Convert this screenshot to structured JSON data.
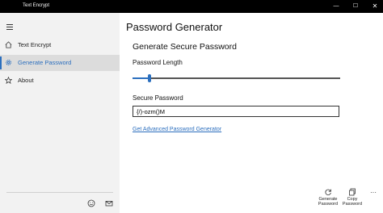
{
  "window": {
    "title": "Text Encrypt",
    "min_glyph": "—",
    "max_glyph": "☐",
    "close_glyph": "✕"
  },
  "sidebar": {
    "items": [
      {
        "label": "Text Encrypt",
        "icon": "home-icon",
        "active": false
      },
      {
        "label": "Generate Password",
        "icon": "gear-icon",
        "active": true
      },
      {
        "label": "About",
        "icon": "star-icon",
        "active": false
      }
    ],
    "footer_icons": [
      "feedback-icon",
      "mail-icon"
    ]
  },
  "main": {
    "page_title": "Password Generator",
    "section_title": "Generate Secure Password",
    "length_label": "Password Length",
    "length_slider": 0.05,
    "secure_label": "Secure Password",
    "secure_value": "{/)-ozm()M",
    "advanced_link": "Get Advanced Password Generator"
  },
  "commandbar": {
    "generate_line1": "Generate",
    "generate_line2": "Password",
    "copy_line1": "Copy",
    "copy_line2": "Password",
    "more_glyph": "···"
  },
  "colors": {
    "accent": "#2c6fbe",
    "titlebar": "#000000",
    "sidebar": "#f2f2f2"
  }
}
